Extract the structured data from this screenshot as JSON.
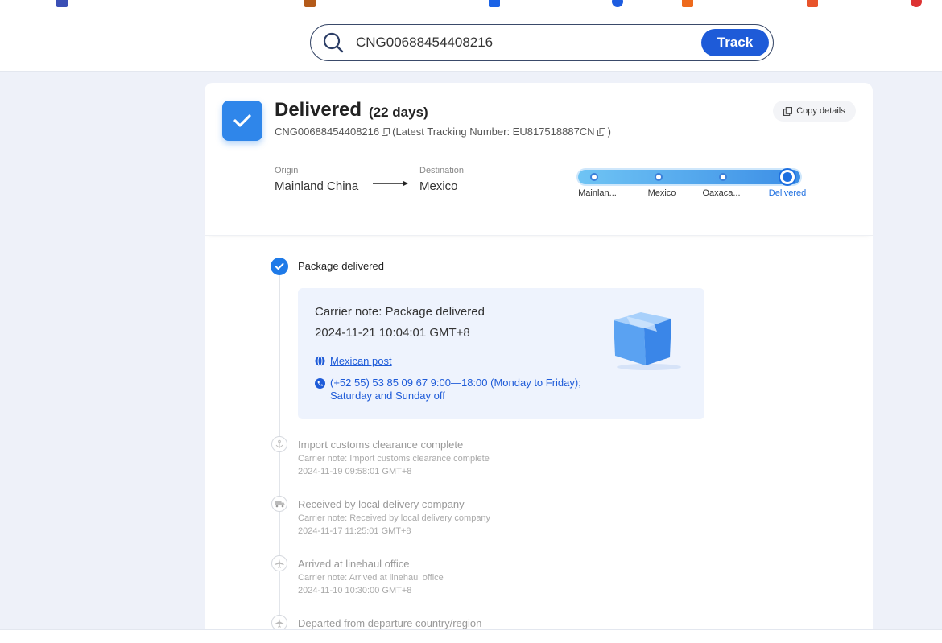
{
  "search": {
    "value": "CNG00688454408216",
    "button_label": "Track"
  },
  "summary": {
    "status": "Delivered",
    "days": "(22 days)",
    "tracking_number": "CNG00688454408216",
    "latest_prefix": "(Latest Tracking Number: EU817518887CN",
    "latest_suffix": ")",
    "copy_label": "Copy details",
    "origin_label": "Origin",
    "origin_value": "Mainland China",
    "destination_label": "Destination",
    "destination_value": "Mexico",
    "stops": [
      "Mainlan...",
      "Mexico",
      "Oaxaca...",
      "Delivered"
    ]
  },
  "current_event": {
    "title": "Package delivered",
    "note": "Carrier note: Package delivered",
    "time": "2024-11-21 10:04:01 GMT+8",
    "carrier": "Mexican post",
    "phone_line1": "(+52 55) 53 85 09 67 9:00—18:00 (Monday to Friday);",
    "phone_line2": "Saturday and Sunday off"
  },
  "events": [
    {
      "title": "Import customs clearance complete",
      "note": "Carrier note: Import customs clearance complete",
      "time": "2024-11-19 09:58:01 GMT+8",
      "icon": "anchor-icon"
    },
    {
      "title": "Received by local delivery company",
      "note": "Carrier note: Received by local delivery company",
      "time": "2024-11-17 11:25:01 GMT+8",
      "icon": "truck-icon"
    },
    {
      "title": "Arrived at linehaul office",
      "note": "Carrier note: Arrived at linehaul office",
      "time": "2024-11-10 10:30:00 GMT+8",
      "icon": "plane-icon"
    },
    {
      "title": "Departed from departure country/region",
      "icon": "plane-icon"
    }
  ],
  "colors": {
    "accent": "#1e5bd8",
    "check": "#2f86ea",
    "background": "#eef1f9"
  }
}
